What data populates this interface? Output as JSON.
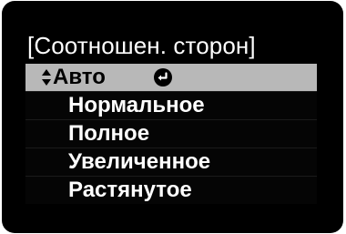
{
  "menu": {
    "title": "[Соотношен. сторон]",
    "items": [
      {
        "label": "Авто",
        "selected": true
      },
      {
        "label": "Нормальное",
        "selected": false
      },
      {
        "label": "Полное",
        "selected": false
      },
      {
        "label": "Увеличенное",
        "selected": false
      },
      {
        "label": "Растянутое",
        "selected": false
      }
    ]
  },
  "icons": {
    "arrows": "up-down-arrows-icon",
    "enter": "enter-icon"
  },
  "colors": {
    "background": "#000000",
    "selected_background": "#b8b8b8",
    "text": "#ffffff",
    "selected_text": "#000000"
  }
}
